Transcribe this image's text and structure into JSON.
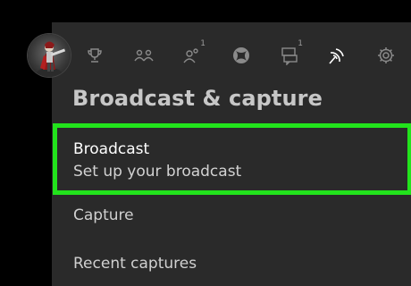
{
  "header": {
    "avatar": "gamer-avatar",
    "icons": [
      {
        "name": "achievements-trophy-icon",
        "badge": ""
      },
      {
        "name": "friends-icon",
        "badge": ""
      },
      {
        "name": "party-icon",
        "badge": "1"
      },
      {
        "name": "xbox-home-icon",
        "badge": ""
      },
      {
        "name": "messages-icon",
        "badge": "1"
      },
      {
        "name": "broadcast-icon",
        "badge": ""
      },
      {
        "name": "settings-gear-icon",
        "badge": ""
      }
    ]
  },
  "main": {
    "title": "Broadcast & capture",
    "items": [
      {
        "label": "Broadcast",
        "sublabel": "Set up your broadcast",
        "selected": true
      },
      {
        "label": "Capture"
      },
      {
        "label": "Recent captures"
      }
    ]
  },
  "colors": {
    "background": "#000000",
    "panel": "#2a2a2a",
    "focus_outline": "#22e31c",
    "icon_inactive": "#8a8a8a",
    "icon_active": "#ffffff"
  }
}
